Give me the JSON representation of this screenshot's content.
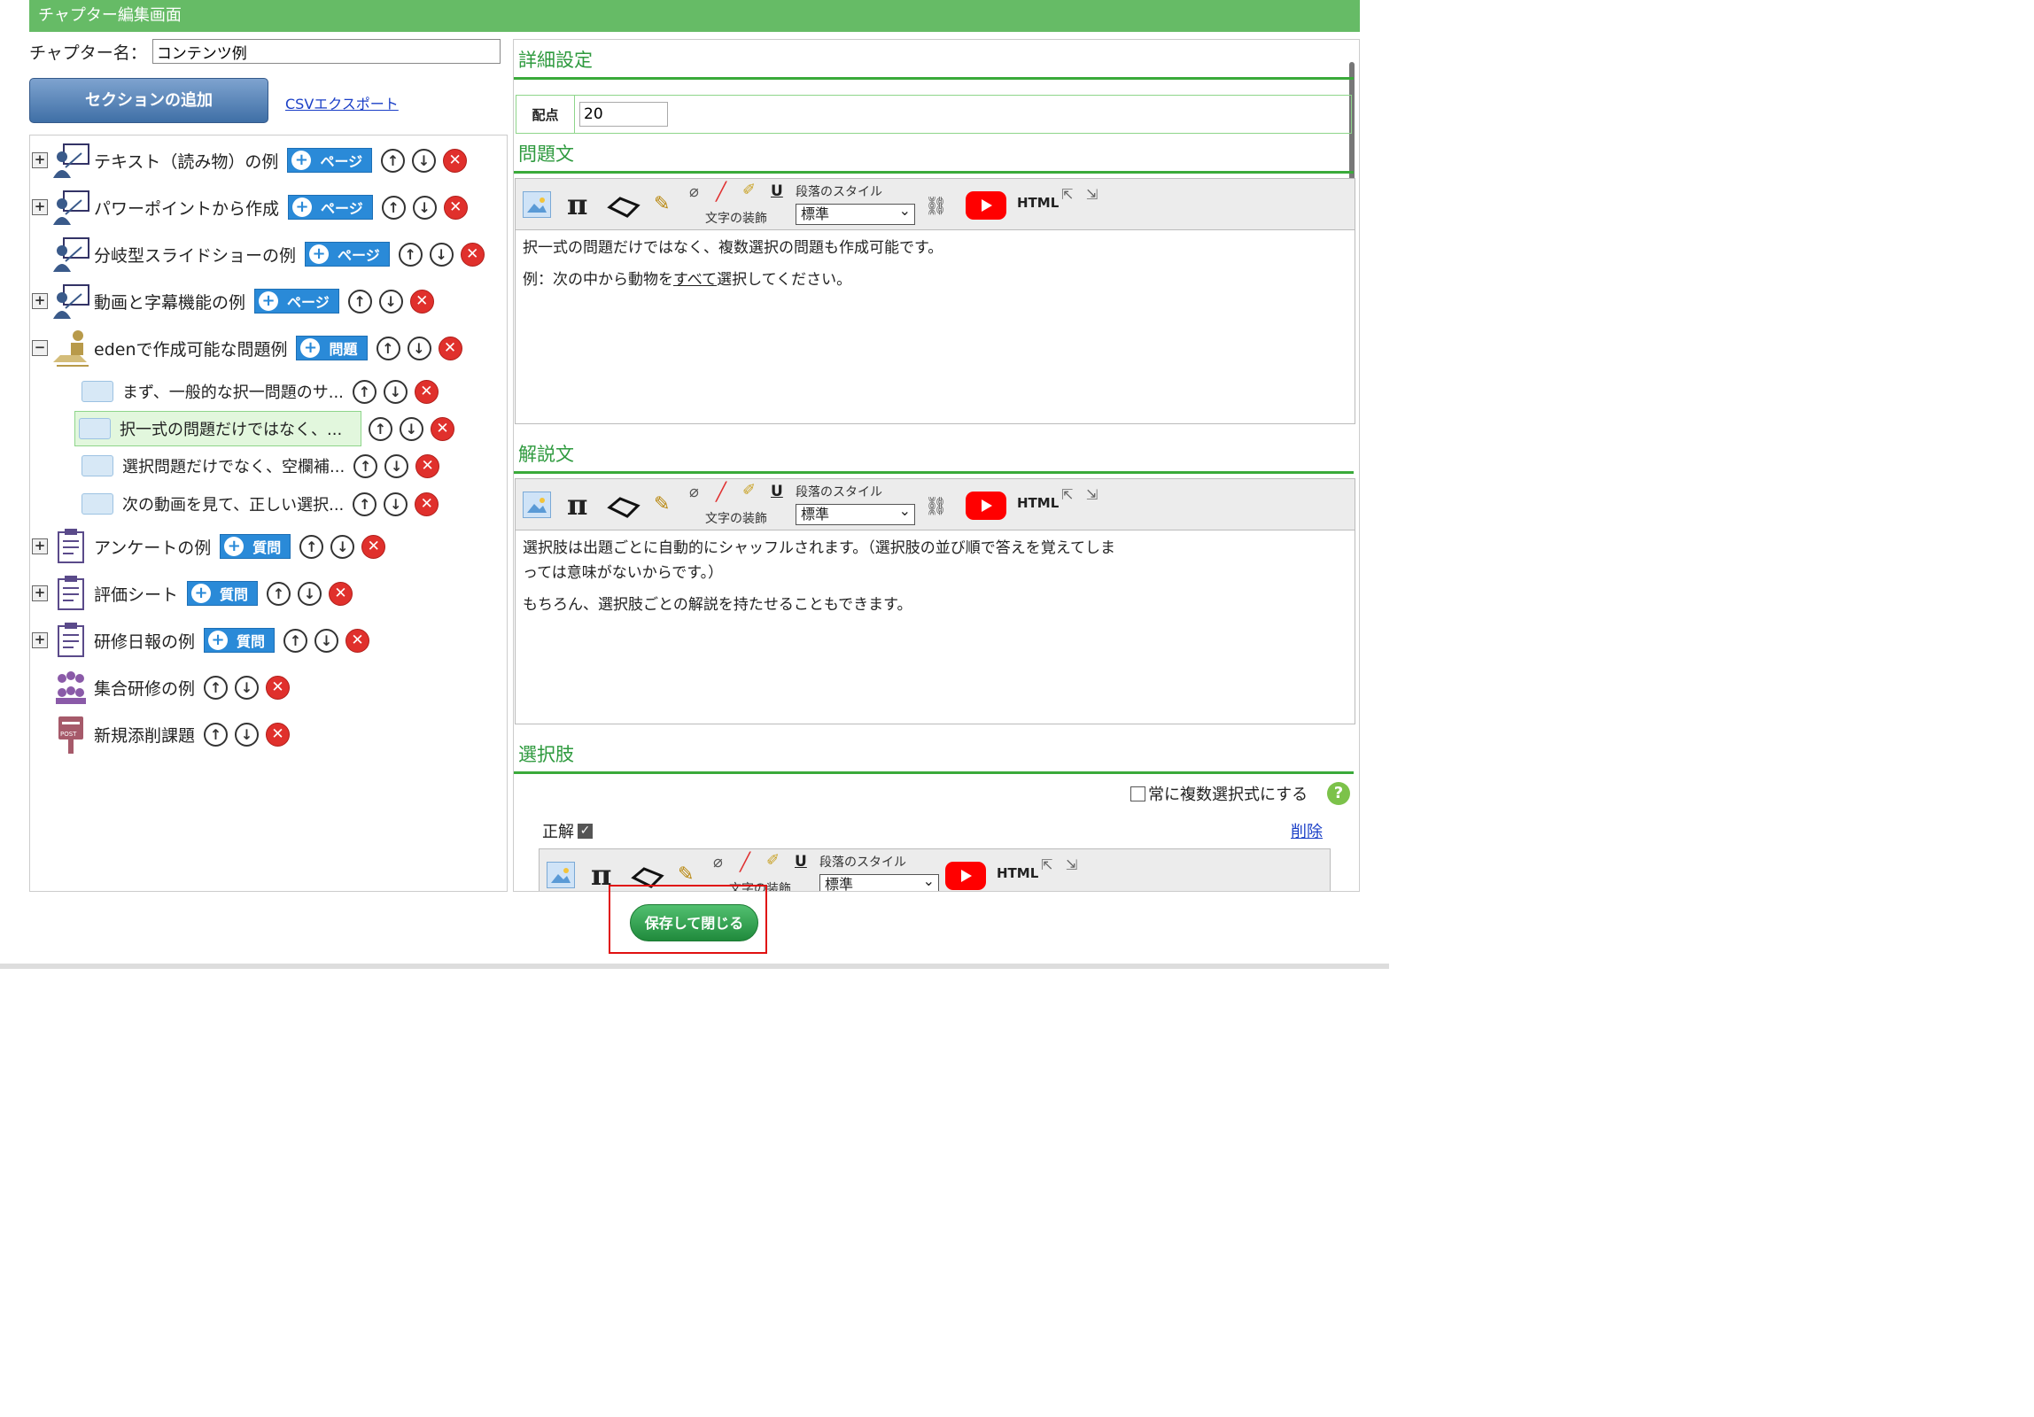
{
  "header": {
    "title": "チャプター編集画面"
  },
  "chapter": {
    "name_label": "チャプター名：",
    "name_value": "コンテンツ例"
  },
  "actions": {
    "add_section": "セクションの追加",
    "csv_export": "CSVエクスポート",
    "save_close": "保存して閉じる"
  },
  "tree": {
    "items": [
      {
        "label": "テキスト（読み物）の例",
        "add": "ページ"
      },
      {
        "label": "パワーポイントから作成",
        "add": "ページ"
      },
      {
        "label": "分岐型スライドショーの例",
        "add": "ページ"
      },
      {
        "label": "動画と字幕機能の例",
        "add": "ページ"
      },
      {
        "label": "edenで作成可能な問題例",
        "add": "問題"
      },
      {
        "label": "アンケートの例",
        "add": "質問"
      },
      {
        "label": "評価シート",
        "add": "質問"
      },
      {
        "label": "研修日報の例",
        "add": "質問"
      },
      {
        "label": "集合研修の例"
      },
      {
        "label": "新規添削課題"
      }
    ],
    "sub": [
      {
        "label": "まず、一般的な択一問題のサ..."
      },
      {
        "label": "択一式の問題だけではなく、..."
      },
      {
        "label": "選択問題だけでなく、空欄補..."
      },
      {
        "label": "次の動画を見て、正しい選択..."
      }
    ]
  },
  "detail": {
    "settings_title": "詳細設定",
    "points_label": "配点",
    "points_value": "20",
    "question_title": "問題文",
    "explanation_title": "解説文",
    "choices_title": "選択肢",
    "toolbar": {
      "paragraph_style": "段落のスタイル",
      "text_decoration": "文字の装飾",
      "style_value": "標準",
      "html": "HTML"
    },
    "question_text": {
      "p1": "択一式の問題だけではなく、複数選択の問題も作成可能です。",
      "p2_a": "例：次の中から動物を",
      "p2_b": "すべて",
      "p2_c": "選択してください。"
    },
    "explanation_text": {
      "p1": "選択肢は出題ごとに自動的にシャッフルされます。（選択肢の並び順で答えを覚えてしま",
      "p1b": "っては意味がないからです。）",
      "p2": "もちろん、選択肢ごとの解説を持たせることもできます。"
    },
    "always_multi": "常に複数選択式にする",
    "correct_label": "正解",
    "delete_link": "削除"
  },
  "colors": {
    "header_green": "#66bb66",
    "section_green": "#2e9a3e",
    "add_blue": "#2a8ad8",
    "delete_red": "#e0302c"
  }
}
